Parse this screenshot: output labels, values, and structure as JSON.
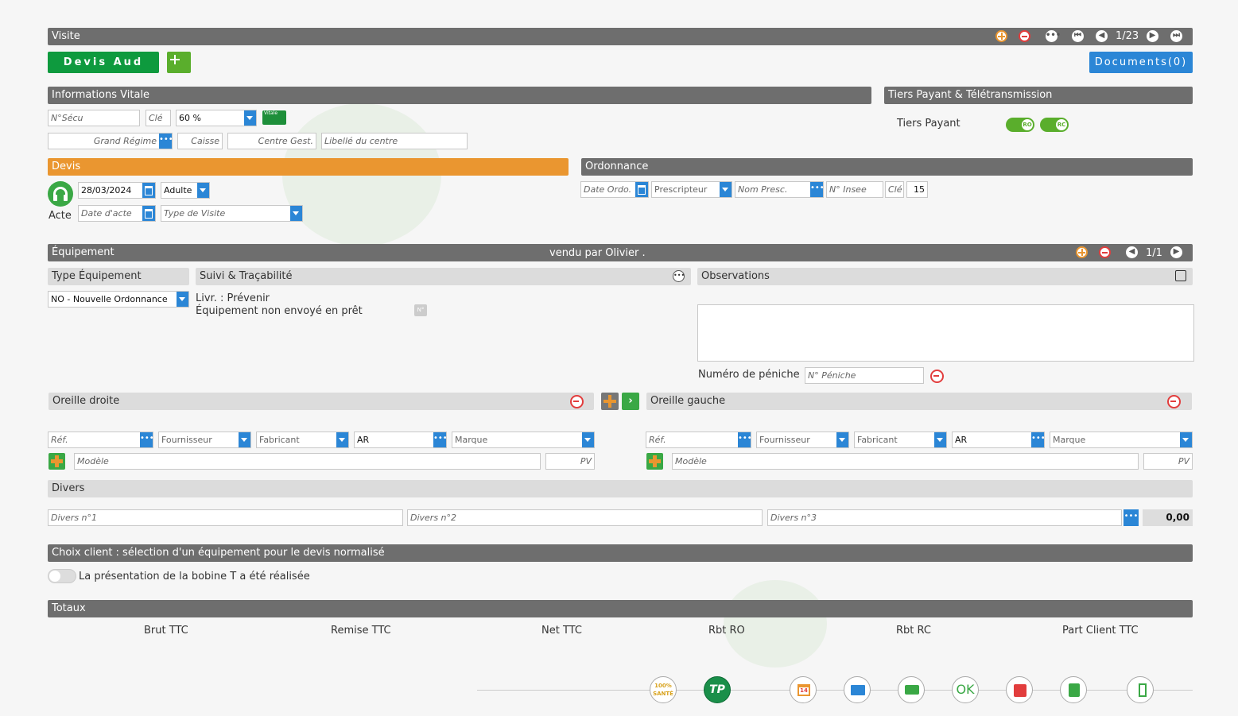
{
  "visite": {
    "title": "Visite",
    "pagination": "1/23",
    "devis_btn": "Devis Aud",
    "documents_btn": "Documents(0)"
  },
  "vitale": {
    "title": "Informations Vitale",
    "nsecu_ph": "N°Sécu",
    "cle_ph": "Clé",
    "taux": "60 %",
    "grand_regime_ph": "Grand Régime",
    "caisse_ph": "Caisse",
    "centre_ph": "Centre Gest.",
    "libelle_ph": "Libellé du centre",
    "card_label": "Vitale"
  },
  "tiers": {
    "title": "Tiers Payant & Télétransmission",
    "label": "Tiers Payant",
    "ro": "RO",
    "rc": "RC"
  },
  "devis": {
    "title": "Devis",
    "date": "28/03/2024",
    "type_patient": "Adulte",
    "acte_label": "Acte",
    "date_acte_ph": "Date d'acte",
    "type_visite_ph": "Type de Visite"
  },
  "ordonnance": {
    "title": "Ordonnance",
    "date_ph": "Date Ordo.",
    "prescripteur_ph": "Prescripteur",
    "nom_ph": "Nom Presc.",
    "insee_ph": "N° Insee",
    "cle_ph": "Clé",
    "cle_val": "15"
  },
  "equipement": {
    "title": "Équipement",
    "vendu": "vendu par Olivier .",
    "pagination": "1/1",
    "type_title": "Type Équipement",
    "type_value": "NO - Nouvelle Ordonnance",
    "suivi_title": "Suivi & Traçabilité",
    "livr": "Livr. : Prévenir",
    "pret": "Équipement non envoyé en prêt",
    "obs_title": "Observations",
    "peniche_label": "Numéro de péniche",
    "peniche_ph": "N° Péniche"
  },
  "oreille_droite": {
    "title": "Oreille droite",
    "ref_ph": "Réf.",
    "fournisseur_ph": "Fournisseur",
    "fabricant_ph": "Fabricant",
    "ar": "AR",
    "marque_ph": "Marque",
    "modele_ph": "Modèle",
    "pv_ph": "PV"
  },
  "oreille_gauche": {
    "title": "Oreille gauche",
    "ref_ph": "Réf.",
    "fournisseur_ph": "Fournisseur",
    "fabricant_ph": "Fabricant",
    "ar": "AR",
    "marque_ph": "Marque",
    "modele_ph": "Modèle",
    "pv_ph": "PV"
  },
  "divers": {
    "title": "Divers",
    "d1_ph": "Divers n°1",
    "d2_ph": "Divers n°2",
    "d3_ph": "Divers n°3",
    "total": "0,00"
  },
  "choix": {
    "title": "Choix client : sélection d'un équipement pour le devis normalisé",
    "bobine": "La présentation de la bobine T a été réalisée"
  },
  "totaux": {
    "title": "Totaux",
    "cols": [
      "Brut TTC",
      "Remise TTC",
      "Net TTC",
      "Rbt RO",
      "Rbt RC",
      "Part Client TTC"
    ]
  },
  "toolbar": {
    "sante": "100% SANTÉ",
    "tp": "TP",
    "ok": "OK",
    "cal_day": "14"
  },
  "colors": {
    "dark_bar": "#6e6e6e",
    "orange": "#ea9630",
    "green": "#5aae2c",
    "blue": "#2b86d6",
    "dark_green": "#0e9a3e"
  }
}
